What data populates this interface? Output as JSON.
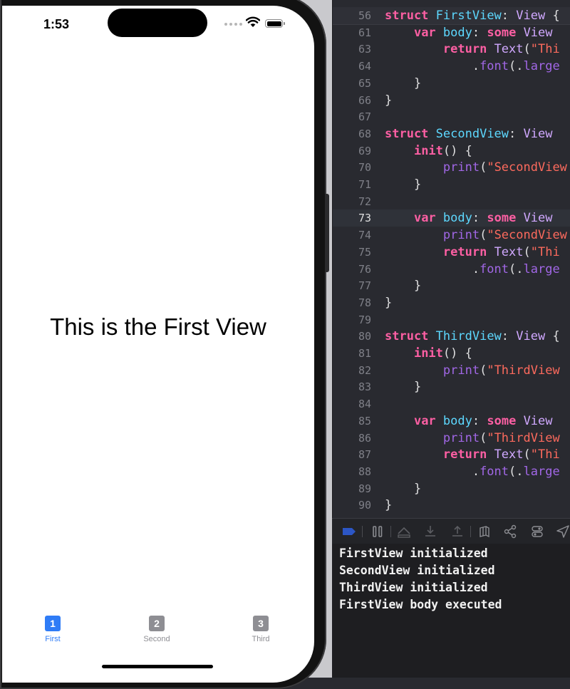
{
  "simulator": {
    "status_time": "1:53",
    "main_text": "This is the First View",
    "tabs": [
      {
        "badge": "1",
        "label": "First",
        "state": "active"
      },
      {
        "badge": "2",
        "label": "Second",
        "state": "inactive"
      },
      {
        "badge": "3",
        "label": "Third",
        "state": "inactive"
      }
    ]
  },
  "editor": {
    "lines": [
      {
        "n": "56",
        "tokens": [
          [
            "kw",
            "struct"
          ],
          [
            "pl",
            " "
          ],
          [
            "ty",
            "FirstView"
          ],
          [
            "pl",
            ": "
          ],
          [
            "ty2",
            "View"
          ],
          [
            "pl",
            " {"
          ]
        ]
      },
      {
        "n": "61",
        "tokens": [
          [
            "pl",
            "    "
          ],
          [
            "kw",
            "var"
          ],
          [
            "pl",
            " "
          ],
          [
            "ty",
            "body"
          ],
          [
            "pl",
            ": "
          ],
          [
            "kw",
            "some"
          ],
          [
            "pl",
            " "
          ],
          [
            "ty2",
            "View"
          ]
        ]
      },
      {
        "n": "63",
        "tokens": [
          [
            "pl",
            "        "
          ],
          [
            "kw",
            "return"
          ],
          [
            "pl",
            " "
          ],
          [
            "ty2",
            "Text"
          ],
          [
            "pl",
            "("
          ],
          [
            "str",
            "\"Thi"
          ]
        ]
      },
      {
        "n": "64",
        "tokens": [
          [
            "pl",
            "            ."
          ],
          [
            "fn",
            "font"
          ],
          [
            "pl",
            "(."
          ],
          [
            "fn",
            "large"
          ]
        ]
      },
      {
        "n": "65",
        "tokens": [
          [
            "pl",
            "    }"
          ]
        ]
      },
      {
        "n": "66",
        "tokens": [
          [
            "pl",
            "}"
          ]
        ]
      },
      {
        "n": "67",
        "tokens": []
      },
      {
        "n": "68",
        "tokens": [
          [
            "kw",
            "struct"
          ],
          [
            "pl",
            " "
          ],
          [
            "ty",
            "SecondView"
          ],
          [
            "pl",
            ": "
          ],
          [
            "ty2",
            "View"
          ]
        ]
      },
      {
        "n": "69",
        "tokens": [
          [
            "pl",
            "    "
          ],
          [
            "kw",
            "init"
          ],
          [
            "pl",
            "() {"
          ]
        ]
      },
      {
        "n": "70",
        "tokens": [
          [
            "pl",
            "        "
          ],
          [
            "fn",
            "print"
          ],
          [
            "pl",
            "("
          ],
          [
            "str",
            "\"SecondView"
          ]
        ]
      },
      {
        "n": "71",
        "tokens": [
          [
            "pl",
            "    }"
          ]
        ]
      },
      {
        "n": "72",
        "tokens": []
      },
      {
        "n": "73",
        "tokens": [
          [
            "pl",
            "    "
          ],
          [
            "kw",
            "var"
          ],
          [
            "pl",
            " "
          ],
          [
            "ty",
            "body"
          ],
          [
            "pl",
            ": "
          ],
          [
            "kw",
            "some"
          ],
          [
            "pl",
            " "
          ],
          [
            "ty2",
            "View"
          ]
        ]
      },
      {
        "n": "74",
        "tokens": [
          [
            "pl",
            "        "
          ],
          [
            "fn",
            "print"
          ],
          [
            "pl",
            "("
          ],
          [
            "str",
            "\"SecondView"
          ]
        ]
      },
      {
        "n": "75",
        "tokens": [
          [
            "pl",
            "        "
          ],
          [
            "kw",
            "return"
          ],
          [
            "pl",
            " "
          ],
          [
            "ty2",
            "Text"
          ],
          [
            "pl",
            "("
          ],
          [
            "str",
            "\"Thi"
          ]
        ]
      },
      {
        "n": "76",
        "tokens": [
          [
            "pl",
            "            ."
          ],
          [
            "fn",
            "font"
          ],
          [
            "pl",
            "(."
          ],
          [
            "fn",
            "large"
          ]
        ]
      },
      {
        "n": "77",
        "tokens": [
          [
            "pl",
            "    }"
          ]
        ]
      },
      {
        "n": "78",
        "tokens": [
          [
            "pl",
            "}"
          ]
        ]
      },
      {
        "n": "79",
        "tokens": []
      },
      {
        "n": "80",
        "tokens": [
          [
            "kw",
            "struct"
          ],
          [
            "pl",
            " "
          ],
          [
            "ty",
            "ThirdView"
          ],
          [
            "pl",
            ": "
          ],
          [
            "ty2",
            "View"
          ],
          [
            "pl",
            " {"
          ]
        ]
      },
      {
        "n": "81",
        "tokens": [
          [
            "pl",
            "    "
          ],
          [
            "kw",
            "init"
          ],
          [
            "pl",
            "() {"
          ]
        ]
      },
      {
        "n": "82",
        "tokens": [
          [
            "pl",
            "        "
          ],
          [
            "fn",
            "print"
          ],
          [
            "pl",
            "("
          ],
          [
            "str",
            "\"ThirdView"
          ]
        ]
      },
      {
        "n": "83",
        "tokens": [
          [
            "pl",
            "    }"
          ]
        ]
      },
      {
        "n": "84",
        "tokens": []
      },
      {
        "n": "85",
        "tokens": [
          [
            "pl",
            "    "
          ],
          [
            "kw",
            "var"
          ],
          [
            "pl",
            " "
          ],
          [
            "ty",
            "body"
          ],
          [
            "pl",
            ": "
          ],
          [
            "kw",
            "some"
          ],
          [
            "pl",
            " "
          ],
          [
            "ty2",
            "View"
          ]
        ]
      },
      {
        "n": "86",
        "tokens": [
          [
            "pl",
            "        "
          ],
          [
            "fn",
            "print"
          ],
          [
            "pl",
            "("
          ],
          [
            "str",
            "\"ThirdView"
          ]
        ]
      },
      {
        "n": "87",
        "tokens": [
          [
            "pl",
            "        "
          ],
          [
            "kw",
            "return"
          ],
          [
            "pl",
            " "
          ],
          [
            "ty2",
            "Text"
          ],
          [
            "pl",
            "("
          ],
          [
            "str",
            "\"Thi"
          ]
        ]
      },
      {
        "n": "88",
        "tokens": [
          [
            "pl",
            "            ."
          ],
          [
            "fn",
            "font"
          ],
          [
            "pl",
            "(."
          ],
          [
            "fn",
            "large"
          ]
        ]
      },
      {
        "n": "89",
        "tokens": [
          [
            "pl",
            "    }"
          ]
        ]
      },
      {
        "n": "90",
        "tokens": [
          [
            "pl",
            "}"
          ]
        ]
      }
    ],
    "current_line": "73"
  },
  "debug_toolbar": {
    "icons": [
      "breakpoint-toggle-icon",
      "pause-icon",
      "step-over-icon",
      "step-into-icon",
      "step-out-icon",
      "view-hierarchy-icon",
      "memory-graph-icon",
      "environment-overrides-icon",
      "location-icon"
    ]
  },
  "console": {
    "lines": [
      "FirstView initialized",
      "SecondView initialized",
      "ThirdView initialized",
      "FirstView body executed"
    ]
  },
  "colors": {
    "tab_active": "#2f7cf6",
    "tab_inactive": "#8e8e93",
    "editor_background": "#292a30",
    "keyword": "#fc5fa3",
    "type": "#5dd8ff",
    "string": "#fc6a5d",
    "function": "#a167e6"
  }
}
